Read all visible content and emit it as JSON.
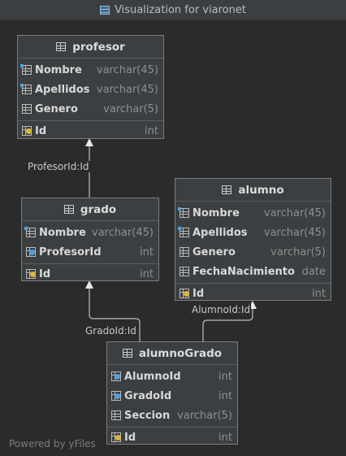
{
  "window": {
    "title": "Visualization for viaronet"
  },
  "footer": {
    "powered_by": "Powered by yFiles"
  },
  "edges": [
    {
      "label": "ProfesorId:Id"
    },
    {
      "label": "GradoId:Id"
    },
    {
      "label": "AlumnoId:Id"
    }
  ],
  "tables": {
    "profesor": {
      "name": "profesor",
      "columns": [
        {
          "name": "Nombre",
          "type": "varchar(45)"
        },
        {
          "name": "Apellidos",
          "type": "varchar(45)"
        },
        {
          "name": "Genero",
          "type": "varchar(5)"
        }
      ],
      "keys": [
        {
          "name": "Id",
          "type": "int"
        }
      ]
    },
    "grado": {
      "name": "grado",
      "columns": [
        {
          "name": "Nombre",
          "type": "varchar(45)"
        },
        {
          "name": "ProfesorId",
          "type": "int"
        }
      ],
      "keys": [
        {
          "name": "Id",
          "type": "int"
        }
      ]
    },
    "alumno": {
      "name": "alumno",
      "columns": [
        {
          "name": "Nombre",
          "type": "varchar(45)"
        },
        {
          "name": "Apellidos",
          "type": "varchar(45)"
        },
        {
          "name": "Genero",
          "type": "varchar(5)"
        },
        {
          "name": "FechaNacimiento",
          "type": "date"
        }
      ],
      "keys": [
        {
          "name": "Id",
          "type": "int"
        }
      ]
    },
    "alumnoGrado": {
      "name": "alumnoGrado",
      "columns": [
        {
          "name": "AlumnoId",
          "type": "int"
        },
        {
          "name": "GradoId",
          "type": "int"
        },
        {
          "name": "Seccion",
          "type": "varchar(5)"
        }
      ],
      "keys": [
        {
          "name": "Id",
          "type": "int"
        }
      ]
    }
  }
}
